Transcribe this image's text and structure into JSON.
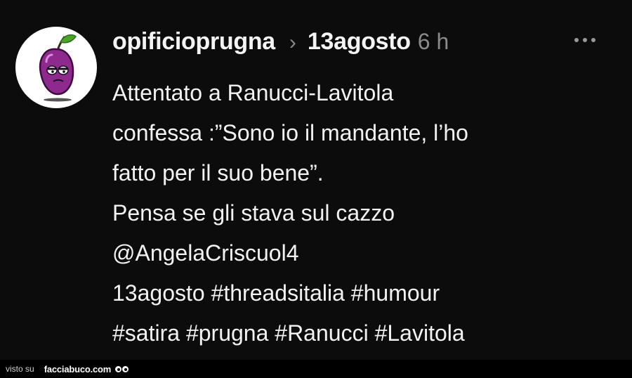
{
  "post": {
    "username": "opificioprugna",
    "separator": "›",
    "topic": "13agosto",
    "time": "6 h",
    "body_lines": [
      "Attentato a Ranucci-Lavitola",
      "confessa :”Sono io il mandante, l’ho",
      "fatto per il suo bene”.",
      "Pensa se gli stava sul cazzo",
      "@AngelaCriscuol4",
      "13agosto #threadsitalia #humour",
      "#satira #prugna #Ranucci #Lavitola"
    ],
    "avatar_icon": "plum-mascot-icon",
    "more_icon": "more-options-icon"
  },
  "watermark": {
    "prefix": "visto su",
    "site": "facciabuco.com",
    "icon": "eyes-icon"
  },
  "colors": {
    "background": "#0c0c0c",
    "text": "#f2f2f2",
    "muted": "#8a8a8a",
    "avatar_plum": "#8e2a8e"
  }
}
